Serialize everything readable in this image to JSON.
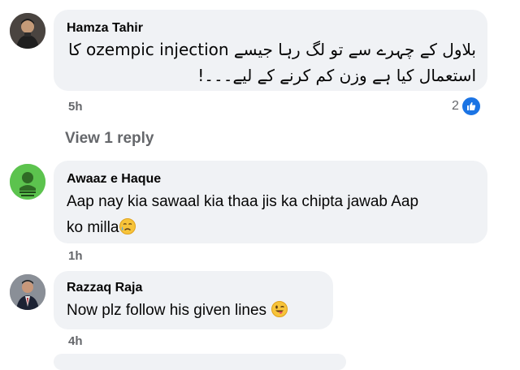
{
  "comments": [
    {
      "author": "Hamza Tahir",
      "text_line1": "بلاول کے چہرے سے تو لگ رہا جیسے ozempic injection کا",
      "text_line2": "استعمال کیا ہے وزن کم کرنے کے لیے۔۔۔!",
      "time": "5h",
      "reaction_count": "2",
      "reaction_icon": "thumbs-up-icon",
      "view_replies": "View 1 reply"
    },
    {
      "author": "Awaaz e Haque",
      "text_line1": "Aap nay kia sawaal kia thaa jis ka chipta jawab Aap",
      "text_line2": "ko milla",
      "emoji": "crying-face-icon",
      "time": "1h"
    },
    {
      "author": "Razzaq Raja",
      "text_line1": "Now plz follow his given lines",
      "emoji": "winking-tongue-face-icon",
      "time": "4h"
    }
  ],
  "colors": {
    "bubble": "#f0f2f5",
    "meta_text": "#65676b",
    "like_blue": "#1b74e4",
    "avatar_green": "#5cc34e"
  }
}
